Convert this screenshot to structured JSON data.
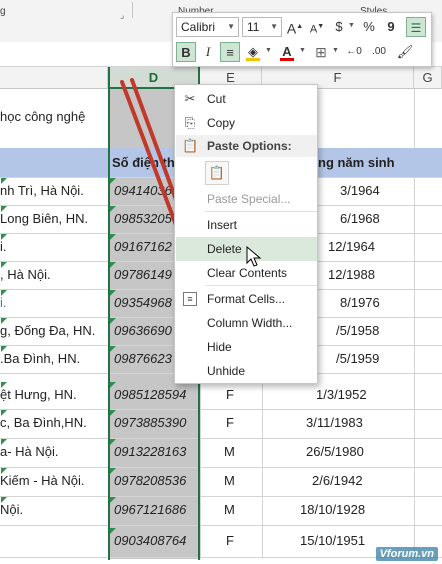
{
  "ribbon": {
    "group_left_fragment": "g",
    "group_number_label": "Number",
    "group_styles_label": "Styles"
  },
  "columns": [
    "D",
    "E",
    "F",
    "G"
  ],
  "sheet": {
    "header": {
      "address_fragment": "",
      "phone_label": "Số điện th",
      "birth_label": "ng năm sinh"
    },
    "title_fragment": "học công nghệ",
    "rows": [
      {
        "address": "nh Trì, Hà Nội.",
        "phone": "09414036",
        "gender": "",
        "birth": "3/1964"
      },
      {
        "address": "Long Biên, HN.",
        "phone": "09853205",
        "gender": "",
        "birth": "6/1968"
      },
      {
        "address": "i.",
        "phone": "09167162",
        "gender": "",
        "birth": "12/1964"
      },
      {
        "address": ", Hà Nội.",
        "phone": "09786149",
        "gender": "",
        "birth": "12/1988"
      },
      {
        "address": "i.",
        "phone": "09354968",
        "gender": "",
        "birth": "8/1976"
      },
      {
        "address": "g, Đống Đa, HN.",
        "phone": "09636690",
        "gender": "",
        "birth": "/5/1958"
      },
      {
        "address": ".Ba Đình, HN.",
        "phone": "09876623",
        "gender": "",
        "birth": "/5/1959"
      },
      {
        "address": "ệt Hưng, HN.",
        "phone": "0985128594",
        "gender": "F",
        "birth": "1/3/1952"
      },
      {
        "address": "c, Ba Đình,HN.",
        "phone": "0973885390",
        "gender": "F",
        "birth": "3/11/1983"
      },
      {
        "address": "a- Hà Nội.",
        "phone": "0913228163",
        "gender": "M",
        "birth": "26/5/1980"
      },
      {
        "address": "Kiếm - Hà Nội.",
        "phone": "0978208536",
        "gender": "M",
        "birth": "2/6/1942"
      },
      {
        "address": "Nội.",
        "phone": "0967121686",
        "gender": "M",
        "birth": "18/10/1928"
      },
      {
        "address": "",
        "phone": "0903408764",
        "gender": "F",
        "birth": "15/10/1951"
      }
    ]
  },
  "mini_toolbar": {
    "font_name": "Calibri",
    "font_size": "11",
    "increase_font": "A",
    "decrease_font": "A",
    "currency": "$",
    "percent": "%",
    "comma": "9",
    "bold": "B",
    "italic": "I",
    "font_color": "A"
  },
  "context_menu": {
    "cut": "Cut",
    "copy": "Copy",
    "paste_options": "Paste Options:",
    "paste_special": "Paste Special...",
    "insert": "Insert",
    "delete": "Delete",
    "clear_contents": "Clear Contents",
    "format_cells": "Format Cells...",
    "column_width": "Column Width...",
    "hide": "Hide",
    "unhide": "Unhide"
  },
  "watermark": "Vforum.vn",
  "colors": {
    "accent_green": "#217346",
    "header_fill": "#b4c6e7",
    "selection_gray": "#c6c6c6",
    "arrow_red": "#c0392b"
  }
}
